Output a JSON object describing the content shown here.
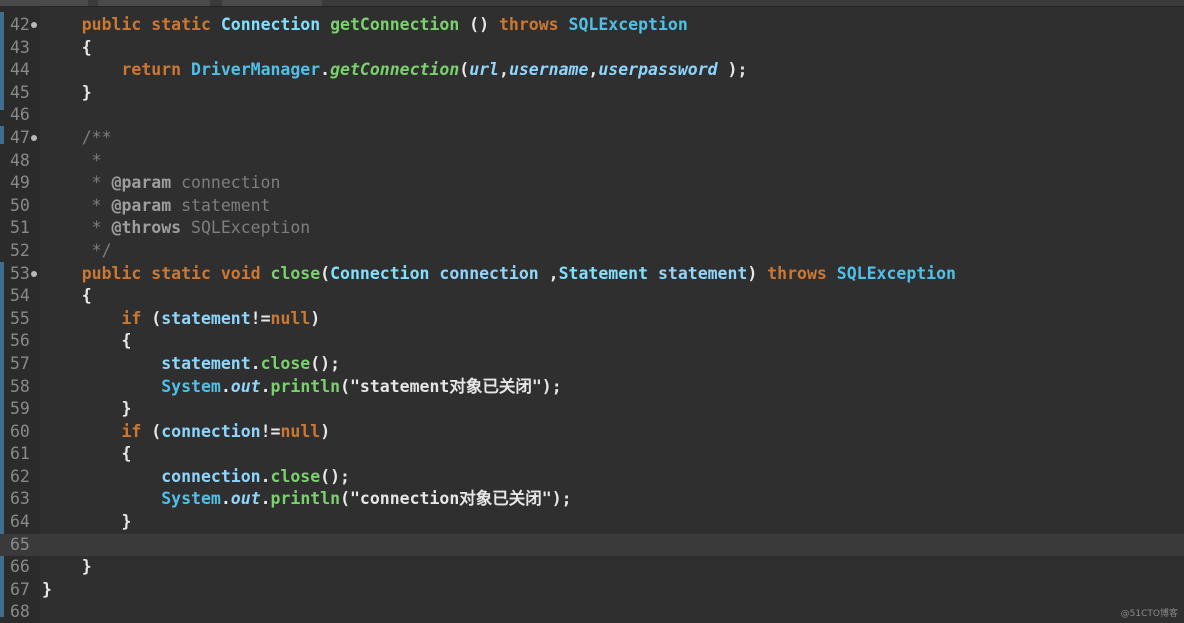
{
  "editor": {
    "background": "#2f2f2f",
    "current_line_number": "65",
    "lines": [
      {
        "num": "42",
        "fold": true,
        "current": false,
        "tokens": [
          {
            "t": "    "
          },
          {
            "t": "public static ",
            "c": "kw"
          },
          {
            "t": "Connection ",
            "c": "cls"
          },
          {
            "t": "getConnection",
            "c": "fn"
          },
          {
            "t": " () ",
            "c": "op"
          },
          {
            "t": "throws ",
            "c": "kw"
          },
          {
            "t": "SQLException",
            "c": "typ"
          }
        ]
      },
      {
        "num": "43",
        "fold": false,
        "current": false,
        "tokens": [
          {
            "t": "    {",
            "c": "op"
          }
        ]
      },
      {
        "num": "44",
        "fold": false,
        "current": false,
        "tokens": [
          {
            "t": "        "
          },
          {
            "t": "return ",
            "c": "kw"
          },
          {
            "t": "DriverManager",
            "c": "typ"
          },
          {
            "t": ".",
            "c": "op"
          },
          {
            "t": "getConnection",
            "c": "fni"
          },
          {
            "t": "(",
            "c": "op"
          },
          {
            "t": "url",
            "c": "idi"
          },
          {
            "t": ",",
            "c": "op"
          },
          {
            "t": "username",
            "c": "idi"
          },
          {
            "t": ",",
            "c": "op"
          },
          {
            "t": "userpassword",
            "c": "idi"
          },
          {
            "t": " );",
            "c": "op"
          }
        ]
      },
      {
        "num": "45",
        "fold": false,
        "current": false,
        "tokens": [
          {
            "t": "    }",
            "c": "op"
          }
        ]
      },
      {
        "num": "46",
        "fold": false,
        "current": false,
        "tokens": []
      },
      {
        "num": "47",
        "fold": true,
        "current": false,
        "tokens": [
          {
            "t": "    /**",
            "c": "cmt"
          }
        ]
      },
      {
        "num": "48",
        "fold": false,
        "current": false,
        "tokens": [
          {
            "t": "     *",
            "c": "cmt"
          }
        ]
      },
      {
        "num": "49",
        "fold": false,
        "current": false,
        "tokens": [
          {
            "t": "     * ",
            "c": "cmt"
          },
          {
            "t": "@param",
            "c": "tag"
          },
          {
            "t": " connection",
            "c": "cmt"
          }
        ]
      },
      {
        "num": "50",
        "fold": false,
        "current": false,
        "tokens": [
          {
            "t": "     * ",
            "c": "cmt"
          },
          {
            "t": "@param",
            "c": "tag"
          },
          {
            "t": " statement",
            "c": "cmt"
          }
        ]
      },
      {
        "num": "51",
        "fold": false,
        "current": false,
        "tokens": [
          {
            "t": "     * ",
            "c": "cmt"
          },
          {
            "t": "@throws",
            "c": "tag"
          },
          {
            "t": " SQLException",
            "c": "cmt"
          }
        ]
      },
      {
        "num": "52",
        "fold": false,
        "current": false,
        "tokens": [
          {
            "t": "     */",
            "c": "cmt"
          }
        ]
      },
      {
        "num": "53",
        "fold": true,
        "current": false,
        "tokens": [
          {
            "t": "    "
          },
          {
            "t": "public static void ",
            "c": "kw"
          },
          {
            "t": "close",
            "c": "fn"
          },
          {
            "t": "(",
            "c": "op"
          },
          {
            "t": "Connection ",
            "c": "cls"
          },
          {
            "t": "connection",
            "c": "id"
          },
          {
            "t": " ,",
            "c": "op"
          },
          {
            "t": "Statement ",
            "c": "cls"
          },
          {
            "t": "statement",
            "c": "id"
          },
          {
            "t": ") ",
            "c": "op"
          },
          {
            "t": "throws ",
            "c": "kw"
          },
          {
            "t": "SQLException",
            "c": "typ"
          }
        ]
      },
      {
        "num": "54",
        "fold": false,
        "current": false,
        "tokens": [
          {
            "t": "    {",
            "c": "op"
          }
        ]
      },
      {
        "num": "55",
        "fold": false,
        "current": false,
        "tokens": [
          {
            "t": "        "
          },
          {
            "t": "if",
            "c": "kw"
          },
          {
            "t": " (",
            "c": "op"
          },
          {
            "t": "statement",
            "c": "id"
          },
          {
            "t": "!=",
            "c": "op"
          },
          {
            "t": "null",
            "c": "kw"
          },
          {
            "t": ")",
            "c": "op"
          }
        ]
      },
      {
        "num": "56",
        "fold": false,
        "current": false,
        "tokens": [
          {
            "t": "        {",
            "c": "op"
          }
        ]
      },
      {
        "num": "57",
        "fold": false,
        "current": false,
        "tokens": [
          {
            "t": "            "
          },
          {
            "t": "statement",
            "c": "id"
          },
          {
            "t": ".",
            "c": "op"
          },
          {
            "t": "close",
            "c": "fn"
          },
          {
            "t": "();",
            "c": "op"
          }
        ]
      },
      {
        "num": "58",
        "fold": false,
        "current": false,
        "tokens": [
          {
            "t": "            "
          },
          {
            "t": "System",
            "c": "typ"
          },
          {
            "t": ".",
            "c": "op"
          },
          {
            "t": "out",
            "c": "field"
          },
          {
            "t": ".",
            "c": "op"
          },
          {
            "t": "println",
            "c": "fn"
          },
          {
            "t": "(",
            "c": "op"
          },
          {
            "t": "\"statement对象已关闭\"",
            "c": "str"
          },
          {
            "t": ");",
            "c": "op"
          }
        ]
      },
      {
        "num": "59",
        "fold": false,
        "current": false,
        "tokens": [
          {
            "t": "        }",
            "c": "op"
          }
        ]
      },
      {
        "num": "60",
        "fold": false,
        "current": false,
        "tokens": [
          {
            "t": "        "
          },
          {
            "t": "if",
            "c": "kw"
          },
          {
            "t": " (",
            "c": "op"
          },
          {
            "t": "connection",
            "c": "id"
          },
          {
            "t": "!=",
            "c": "op"
          },
          {
            "t": "null",
            "c": "kw"
          },
          {
            "t": ")",
            "c": "op"
          }
        ]
      },
      {
        "num": "61",
        "fold": false,
        "current": false,
        "tokens": [
          {
            "t": "        {",
            "c": "op"
          }
        ]
      },
      {
        "num": "62",
        "fold": false,
        "current": false,
        "tokens": [
          {
            "t": "            "
          },
          {
            "t": "connection",
            "c": "id"
          },
          {
            "t": ".",
            "c": "op"
          },
          {
            "t": "close",
            "c": "fn"
          },
          {
            "t": "();",
            "c": "op"
          }
        ]
      },
      {
        "num": "63",
        "fold": false,
        "current": false,
        "tokens": [
          {
            "t": "            "
          },
          {
            "t": "System",
            "c": "typ"
          },
          {
            "t": ".",
            "c": "op"
          },
          {
            "t": "out",
            "c": "field"
          },
          {
            "t": ".",
            "c": "op"
          },
          {
            "t": "println",
            "c": "fn"
          },
          {
            "t": "(",
            "c": "op"
          },
          {
            "t": "\"connection对象已关闭\"",
            "c": "str"
          },
          {
            "t": ");",
            "c": "op"
          }
        ]
      },
      {
        "num": "64",
        "fold": false,
        "current": false,
        "tokens": [
          {
            "t": "        }",
            "c": "op"
          }
        ]
      },
      {
        "num": "65",
        "fold": false,
        "current": true,
        "tokens": []
      },
      {
        "num": "66",
        "fold": false,
        "current": false,
        "tokens": [
          {
            "t": "    }",
            "c": "op"
          }
        ]
      },
      {
        "num": "67",
        "fold": false,
        "current": false,
        "tokens": [
          {
            "t": "}",
            "c": "op"
          }
        ]
      },
      {
        "num": "68",
        "fold": false,
        "current": false,
        "tokens": []
      }
    ]
  },
  "watermark": "@51CTO博客"
}
